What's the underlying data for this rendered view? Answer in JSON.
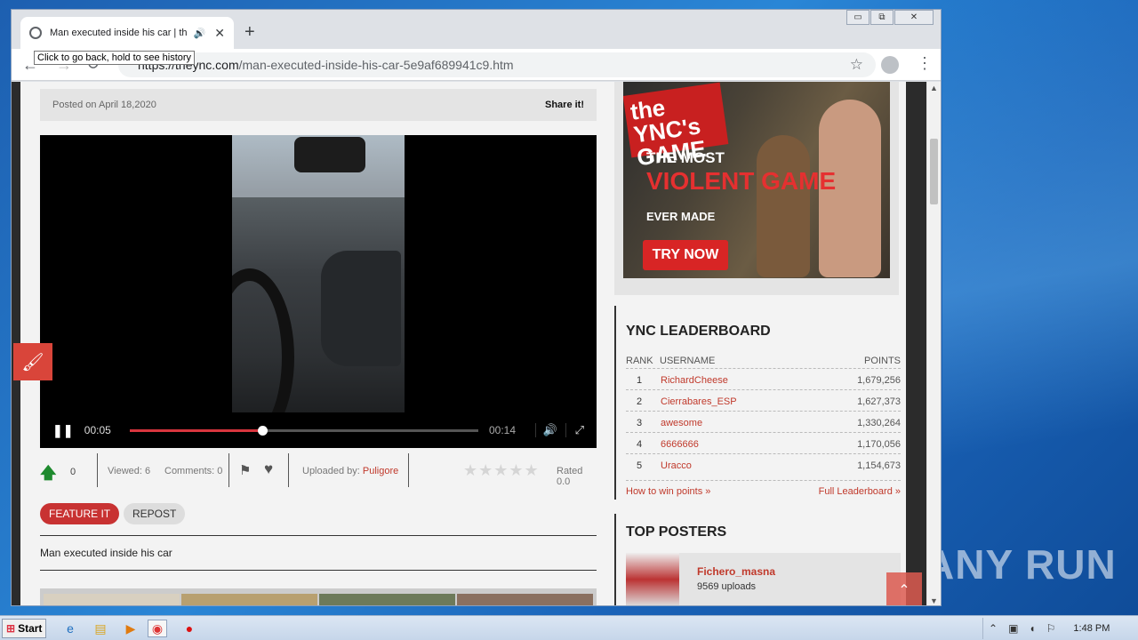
{
  "browser": {
    "tab_title": "Man executed inside his car | th",
    "tab_speaker": "🔊",
    "tab_close": "✕",
    "new_tab": "+",
    "url_host": "https://theync.com",
    "url_path": "/man-executed-inside-his-car-5e9af689941c9.htm",
    "tooltip": "Click to go back, hold to see history",
    "back": "←",
    "forward": "→",
    "reload": "↻",
    "star": "☆",
    "menu": "⋮",
    "win_min": "▭",
    "win_max": "⧉",
    "win_close": "✕"
  },
  "post": {
    "posted": "Posted on April 18,2020",
    "share": "Share it!"
  },
  "player": {
    "pause": "❚❚",
    "current_time": "00:05",
    "duration": "00:14",
    "progress_fraction": 0.38,
    "volume_icon": "🔊",
    "fullscreen_icon": "⤢"
  },
  "stats": {
    "vote_icon": "🡅",
    "vote_count": "0",
    "viewed": "Viewed: 6",
    "comments": "Comments: 0",
    "flag_icon": "⚑",
    "heart_icon": "♥",
    "uploaded_label": "Uploaded by: ",
    "uploader": "Puligore",
    "stars": "★★★★★",
    "rated": "Rated 0.0"
  },
  "actions": {
    "feature": "FEATURE IT",
    "repost": "REPOST"
  },
  "caption": "Man executed inside his car",
  "paint_icon": "🖌",
  "ad": {
    "tag": "the YNC's GAME",
    "line1": "THE MOST",
    "line2": "VIOLENT GAME",
    "line3": "EVER MADE",
    "cta": "TRY NOW"
  },
  "leaderboard": {
    "title": "YNC LEADERBOARD",
    "col_rank": "RANK",
    "col_user": "USERNAME",
    "col_points": "POINTS",
    "rows": [
      {
        "rank": "1",
        "user": "RichardCheese",
        "points": "1,679,256"
      },
      {
        "rank": "2",
        "user": "Cierrabares_ESP",
        "points": "1,627,373"
      },
      {
        "rank": "3",
        "user": "awesome",
        "points": "1,330,264"
      },
      {
        "rank": "4",
        "user": "6666666",
        "points": "1,170,056"
      },
      {
        "rank": "5",
        "user": "Uracco",
        "points": "1,154,673"
      }
    ],
    "how_to": "How to win points »",
    "full": "Full Leaderboard »"
  },
  "top_posters": {
    "title": "TOP POSTERS",
    "name": "Fichero_masna",
    "uploads": "9569 uploads"
  },
  "back_to_top": "⌃",
  "taskbar": {
    "start": "Start",
    "time": "1:48 PM"
  },
  "watermark": "ANY RUN"
}
